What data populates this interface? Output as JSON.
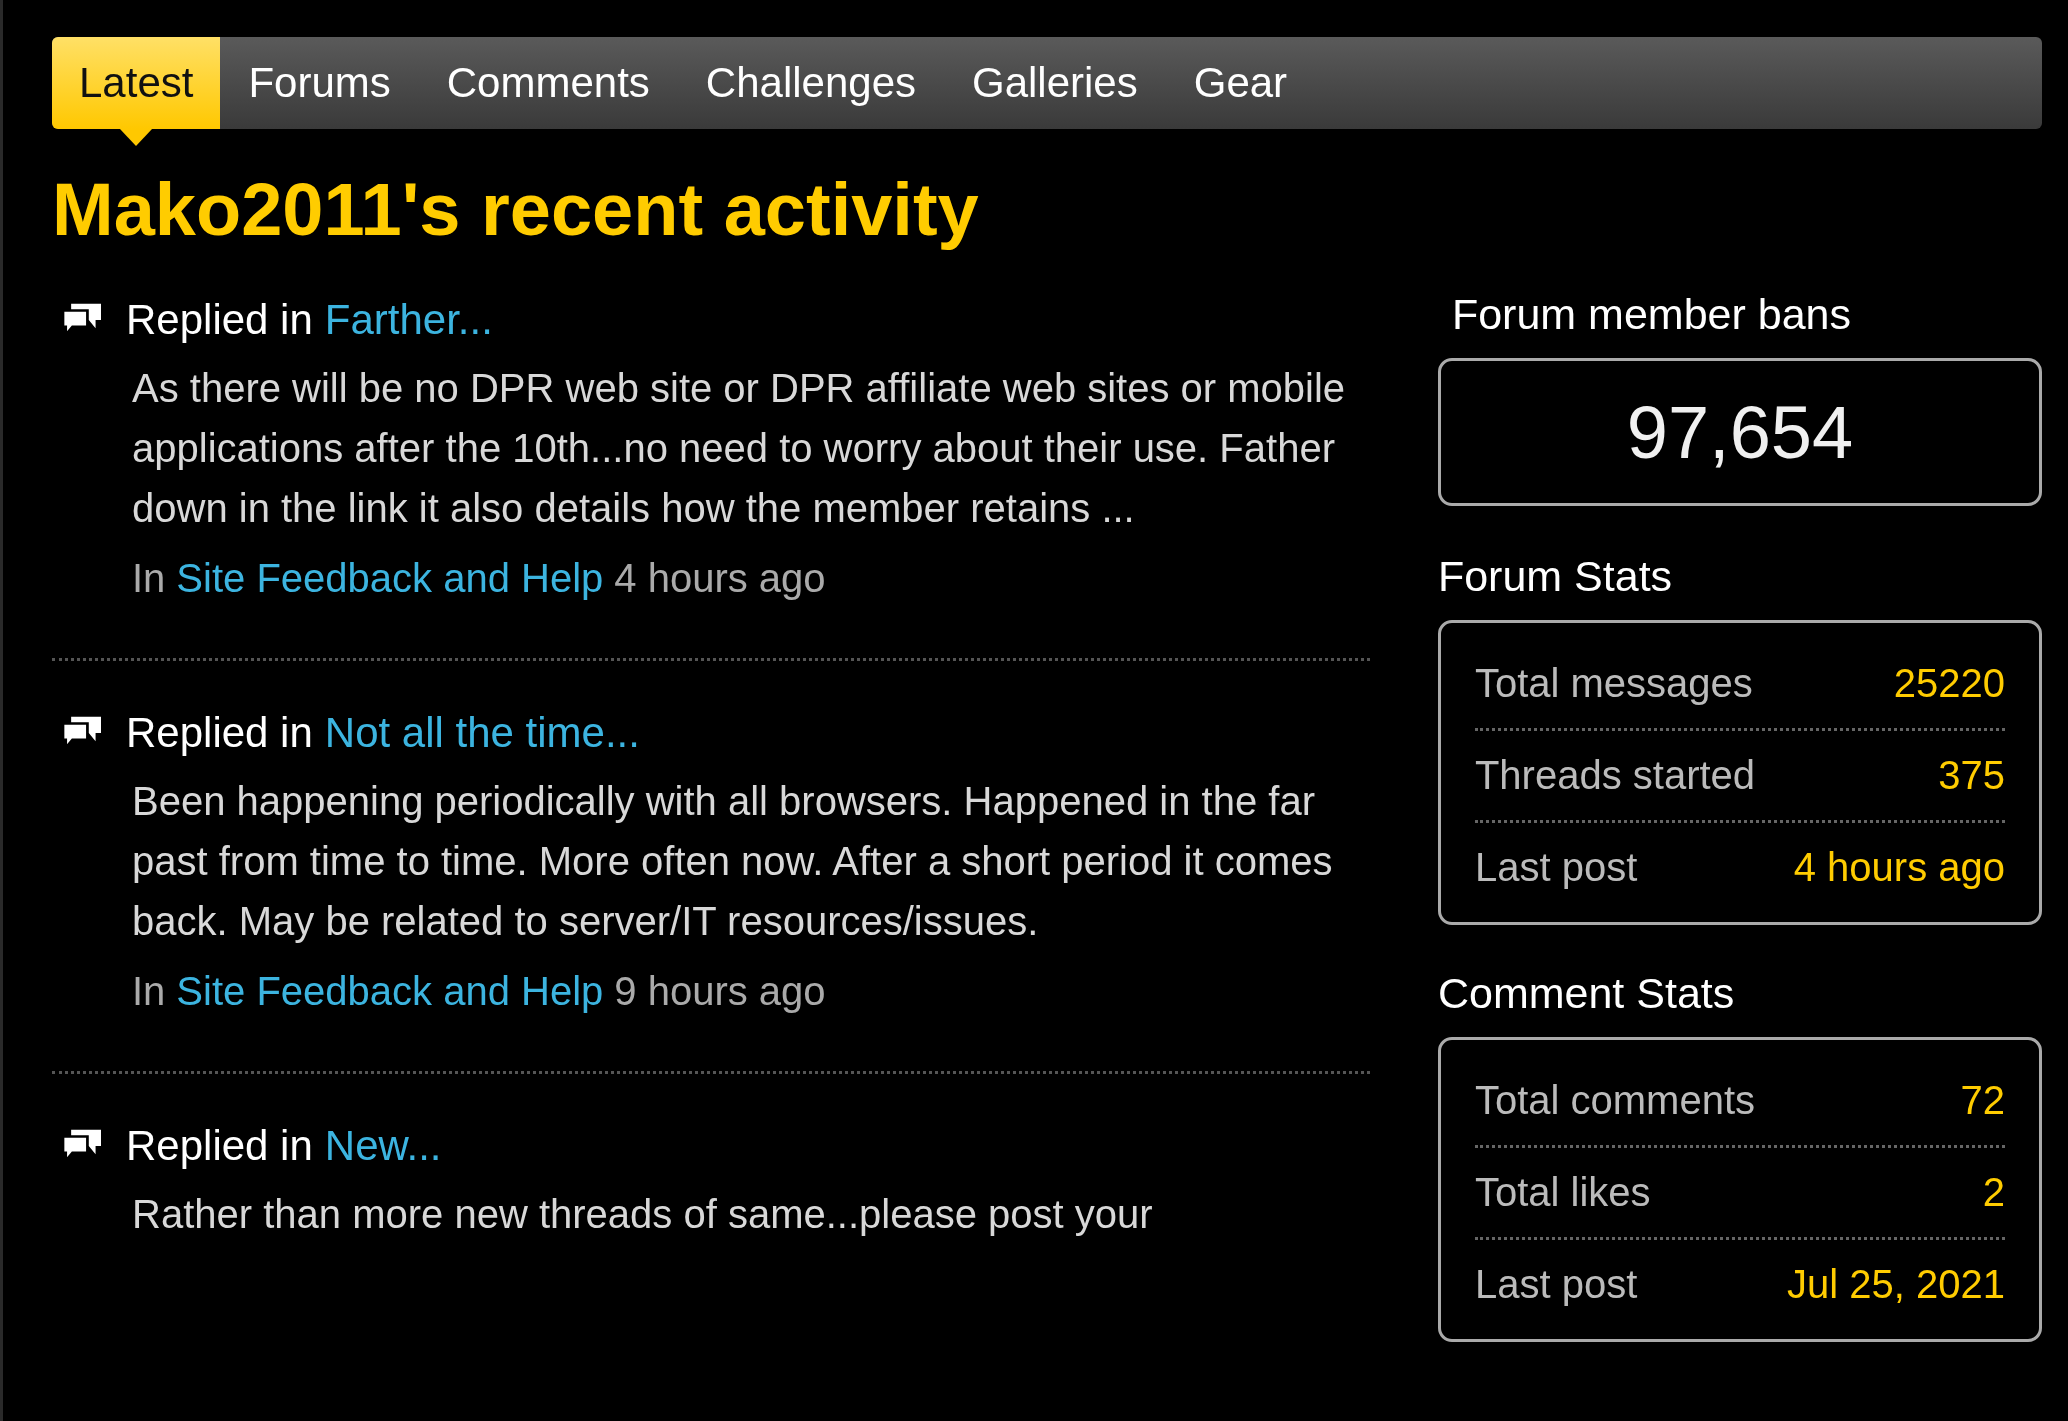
{
  "tabs": [
    {
      "label": "Latest",
      "selected": true
    },
    {
      "label": "Forums",
      "selected": false
    },
    {
      "label": "Comments",
      "selected": false
    },
    {
      "label": "Challenges",
      "selected": false
    },
    {
      "label": "Galleries",
      "selected": false
    },
    {
      "label": "Gear",
      "selected": false
    }
  ],
  "title": "Mako2011's recent activity",
  "activity": [
    {
      "action": "Replied in",
      "thread": "Farther...",
      "excerpt": "As there will be no DPR web site or DPR affiliate web sites or mobile applications after the 10th...no need to worry about their use. Father down in the link it also details how the member retains ...",
      "in_label": "In",
      "forum": "Site Feedback and Help",
      "time": "4 hours ago"
    },
    {
      "action": "Replied in",
      "thread": "Not all the time...",
      "excerpt": "Been happening periodically with all browsers.  Happened in the far past from time to time.  More often now. After a short period it comes back.  May be related to server/IT resources/issues.",
      "in_label": "In",
      "forum": "Site Feedback and Help",
      "time": "9 hours ago"
    },
    {
      "action": "Replied in",
      "thread": "New...",
      "excerpt": "Rather than more new threads of same...please post your"
    }
  ],
  "bans": {
    "heading": "Forum member bans",
    "value": "97,654"
  },
  "stat_panels": [
    {
      "heading": "Forum Stats",
      "rows": [
        {
          "label": "Total messages",
          "value": "25220"
        },
        {
          "label": "Threads started",
          "value": "375"
        },
        {
          "label": "Last post",
          "value": "4 hours ago"
        }
      ]
    },
    {
      "heading": "Comment Stats",
      "rows": [
        {
          "label": "Total comments",
          "value": "72"
        },
        {
          "label": "Total likes",
          "value": "2"
        },
        {
          "label": "Last post",
          "value": "Jul 25, 2021"
        }
      ]
    }
  ]
}
